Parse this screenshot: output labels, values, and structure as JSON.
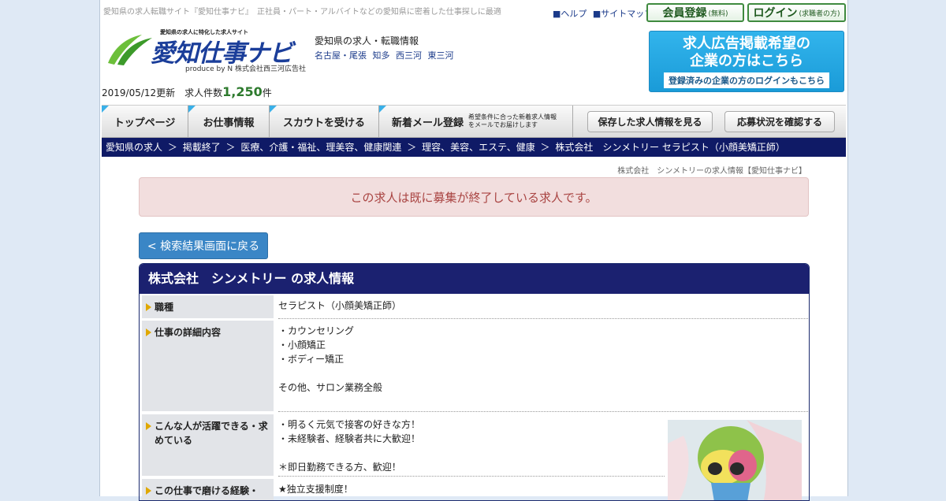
{
  "header": {
    "tagline": "愛知県の求人転職サイト『愛知仕事ナビ』　正社員・パート・アルバイトなどの愛知県に密着した仕事探しに最適",
    "links": [
      "■ヘルプ",
      "■サイトマップ"
    ],
    "member_btn": "会員登録",
    "member_btn_sub": "(無料)",
    "login_btn": "ログイン",
    "login_btn_sub": "(求職者の方)",
    "logo_sub": "愛知県の求人に特化した求人サイト",
    "logo_main": "愛知仕事ナビ",
    "logo_by": "produce by N 株式会社西三河広告社",
    "site_desc": "愛知県の求人・転職情報",
    "regions": [
      "名古屋・尾張",
      "知多",
      "西三河",
      "東三河"
    ],
    "ad_line1": "求人広告掲載希望の",
    "ad_line2": "企業の方はこちら",
    "ad_sub": "登録済みの企業の方のログインもこちら",
    "updated_text": "2019/05/12更新　求人件数",
    "job_count": "1,250",
    "count_unit": "件"
  },
  "nav": {
    "tabs": [
      "トップページ",
      "お仕事情報",
      "スカウトを受ける",
      "新着メール登録"
    ],
    "mail_note": "希望条件に合った新着求人情報をメールでお届けします",
    "saved": "保存した求人情報を見る",
    "status": "応募状況を確認する"
  },
  "breadcrumb": [
    "愛知県の求人",
    "＞",
    "掲載終了",
    "＞",
    "医療、介護・福祉、理美容、健康関連",
    "＞",
    "理容、美容、エステ、健康",
    "＞",
    "株式会社　シンメトリー セラピスト（小顔美矯正師）"
  ],
  "subtitle": "株式会社　シンメトリーの求人情報【愛知仕事ナビ】",
  "notice": "この求人は既に募集が終了している求人です。",
  "back_button": "< 検索結果画面に戻る",
  "job": {
    "title": "株式会社　シンメトリー の求人情報",
    "rows": [
      {
        "label": "職種",
        "value": [
          "セラピスト（小顔美矯正師）"
        ]
      },
      {
        "label": "仕事の詳細内容",
        "value": [
          "・カウンセリング",
          "・小顔矯正",
          "・ボディー矯正",
          "",
          "その他、サロン業務全般"
        ]
      },
      {
        "label": "こんな人が活躍できる・求めている",
        "value": [
          "・明るく元気で接客の好きな方！",
          "・未経験者、経験者共に大歓迎！",
          "",
          "＊即日勤務できる方、歓迎！"
        ]
      },
      {
        "label": "この仕事で磨ける経験・",
        "value": [
          "★独立支援制度！"
        ]
      }
    ]
  }
}
